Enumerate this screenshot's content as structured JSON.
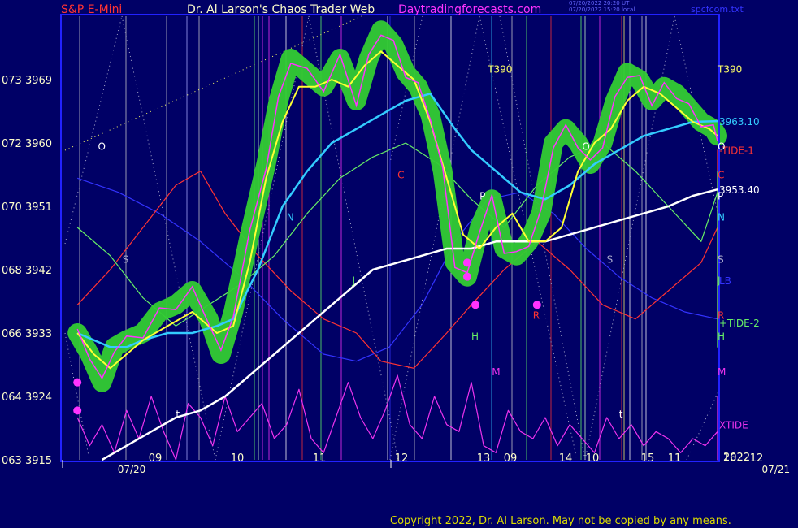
{
  "header": {
    "left_title": "S&P E-Mini",
    "center_title": "Dr. Al Larson's Chaos Trader Web",
    "site": "Daytradingforecasts.com",
    "file": "spcfcom.txt",
    "stamp_line1": "07/20/2022 20:20 UT",
    "stamp_line2": "07/20/2022 15:20 local"
  },
  "copyright": "Copyright 2022, Dr. Al Larson. May not be copied by any means.",
  "colors": {
    "background": "#000066",
    "frame": "#2222ff",
    "price_box": "#33cc33",
    "price": "#ff33ff",
    "short_ma": "#ffff33",
    "long_ma": "#33ccff",
    "trend": "#ffffff",
    "tide1": "#ff3333",
    "tide2": "#66ee66",
    "lb": "#3333ff",
    "xtide": "#ee33ee"
  },
  "chart_data": {
    "type": "line",
    "title": "S&P E-Mini",
    "ylim": [
      3915,
      3978
    ],
    "xlim": [
      8.2,
      16.05
    ],
    "y_ticks": [
      {
        "label": "063 3915",
        "value": 3915
      },
      {
        "label": "064 3924",
        "value": 3924
      },
      {
        "label": "066 3933",
        "value": 3933
      },
      {
        "label": "068 3942",
        "value": 3942
      },
      {
        "label": "070 3951",
        "value": 3951
      },
      {
        "label": "072 3960",
        "value": 3960
      },
      {
        "label": "073 3969",
        "value": 3969
      }
    ],
    "x_ticks_day1": [
      {
        "label": "09",
        "x": 9
      },
      {
        "label": "10",
        "x": 10
      },
      {
        "label": "11",
        "x": 11
      },
      {
        "label": "12",
        "x": 12
      },
      {
        "label": "13",
        "x": 13
      },
      {
        "label": "14",
        "x": 14
      },
      {
        "label": "15",
        "x": 15
      },
      {
        "label": "16",
        "x": 16
      }
    ],
    "x_ticks_day2": [
      {
        "label": "09",
        "x": 9
      },
      {
        "label": "10",
        "x": 10
      },
      {
        "label": "11",
        "x": 11
      },
      {
        "label": "12",
        "x": 12
      },
      {
        "label": "13",
        "x": 13
      },
      {
        "label": "14",
        "x": 14
      },
      {
        "label": "15",
        "x": 15
      },
      {
        "label": "13",
        "x": 16
      }
    ],
    "date_labels": [
      {
        "text": "07/20",
        "x": 8.7
      },
      {
        "text": "07/21",
        "x": 16.55
      }
    ],
    "year_label": "2022",
    "right_labels": [
      {
        "text": "3963.10",
        "value": 3963.1,
        "color": "#33ccff"
      },
      {
        "text": "-TIDE-1",
        "value": 3959.0,
        "color": "#ff3333"
      },
      {
        "text": "3953.40",
        "value": 3953.4,
        "color": "#ffffff"
      },
      {
        "text": "LB",
        "value": 3940.5,
        "color": "#3333ff"
      },
      {
        "text": "+TIDE-2",
        "value": 3934.5,
        "color": "#66ee66"
      },
      {
        "text": "XTIDE",
        "value": 3920.0,
        "color": "#ee33ee"
      }
    ],
    "series": [
      {
        "name": "S&P E-Mini",
        "x": [
          8.2,
          8.35,
          8.5,
          8.65,
          8.8,
          9.0,
          9.2,
          9.4,
          9.6,
          9.8,
          9.95,
          10.1,
          10.3,
          10.5,
          10.65,
          10.8,
          11.0,
          11.2,
          11.4,
          11.6,
          11.75,
          11.9,
          12.05,
          12.2,
          12.35,
          12.5,
          12.65,
          12.8,
          12.95,
          13.1,
          13.25,
          13.4,
          13.55,
          13.7,
          13.85,
          14.0,
          14.15,
          14.3,
          14.45,
          14.6,
          14.75,
          14.9,
          15.05,
          15.2,
          15.35,
          15.5,
          15.65,
          15.8,
          15.95,
          16.0
        ],
        "y": [
          3933,
          3930,
          3926,
          3931,
          3932,
          3933,
          3936,
          3937,
          3939,
          3935,
          3930,
          3936,
          3947,
          3957,
          3966,
          3972,
          3970,
          3968,
          3972,
          3966,
          3972,
          3976,
          3974,
          3970,
          3968,
          3964,
          3956,
          3943,
          3941,
          3948,
          3952,
          3945,
          3944,
          3946,
          3950,
          3960,
          3962,
          3960,
          3957,
          3960,
          3966,
          3970,
          3969,
          3966,
          3968,
          3967,
          3965,
          3963,
          3962,
          3961
        ]
      },
      {
        "name": "",
        "x": [
          8.2,
          8.4,
          8.6,
          8.8,
          9.0,
          9.3,
          9.6,
          9.9,
          10.1,
          10.3,
          10.5,
          10.7,
          10.9,
          11.1,
          11.3,
          11.5,
          11.7,
          11.9,
          12.1,
          12.3,
          12.5,
          12.7,
          12.9,
          13.1,
          13.3,
          13.5,
          13.7,
          13.9,
          14.1,
          14.3,
          14.5,
          14.7,
          14.9,
          15.1,
          15.3,
          15.5,
          15.7,
          15.9,
          16.0
        ],
        "y": [
          3933,
          3930,
          3928,
          3930,
          3932,
          3934,
          3936,
          3933,
          3934,
          3943,
          3955,
          3963,
          3968,
          3968,
          3969,
          3968,
          3971,
          3973,
          3971,
          3969,
          3963,
          3955,
          3947,
          3945,
          3948,
          3950,
          3946,
          3946,
          3948,
          3956,
          3960,
          3962,
          3966,
          3968,
          3967,
          3965,
          3963,
          3962,
          3961
        ]
      },
      {
        "name": "",
        "x": [
          8.2,
          8.4,
          8.6,
          8.8,
          9.0,
          9.3,
          9.6,
          9.9,
          10.1,
          10.4,
          10.7,
          11.0,
          11.3,
          11.6,
          11.9,
          12.2,
          12.5,
          12.8,
          13.0,
          13.3,
          13.6,
          13.9,
          14.2,
          14.5,
          14.8,
          15.1,
          15.4,
          15.7,
          16.0
        ],
        "y": [
          3933,
          3932,
          3931,
          3931,
          3932,
          3933,
          3933,
          3934,
          3935,
          3942,
          3951,
          3956,
          3960,
          3962,
          3964,
          3966,
          3967,
          3962,
          3959,
          3956,
          3953,
          3952,
          3954,
          3957,
          3959,
          3961,
          3962,
          3963,
          3963.1
        ]
      },
      {
        "name": "",
        "x": [
          8.5,
          8.8,
          9.1,
          9.4,
          9.7,
          10.0,
          10.3,
          10.6,
          10.9,
          11.2,
          11.5,
          11.8,
          12.1,
          12.4,
          12.7,
          13.0,
          13.3,
          13.6,
          13.9,
          14.2,
          14.5,
          14.8,
          15.1,
          15.4,
          15.7,
          16.0
        ],
        "y": [
          3915,
          3917,
          3919,
          3921,
          3922,
          3924,
          3927,
          3930,
          3933,
          3936,
          3939,
          3942,
          3943,
          3944,
          3945,
          3945,
          3946,
          3946,
          3946,
          3947,
          3948,
          3949,
          3950,
          3951,
          3952.5,
          3953.4
        ]
      },
      {
        "name": "-TIDE-1",
        "x": [
          8.2,
          8.6,
          9.0,
          9.4,
          9.7,
          10.0,
          10.4,
          10.8,
          11.2,
          11.6,
          11.9,
          12.3,
          12.7,
          13.0,
          13.4,
          13.8,
          14.2,
          14.6,
          15.0,
          15.4,
          15.8,
          16.3,
          16.8,
          17.2,
          17.6,
          18.0,
          18.4,
          18.8,
          19.2,
          19.6,
          20.0,
          20.4,
          20.8,
          21.2,
          21.6,
          22.0,
          22.4,
          22.8,
          23.0
        ],
        "y": [
          3937,
          3942,
          3948,
          3954,
          3956,
          3950,
          3944,
          3939,
          3935,
          3933,
          3929,
          3928,
          3933,
          3937,
          3942,
          3946,
          3942,
          3937,
          3935,
          3939,
          3943,
          3948,
          3958,
          3959,
          3951,
          3943,
          3938,
          3933,
          3934,
          3938,
          3943,
          3947,
          3945,
          3940,
          3937,
          3936,
          3941,
          3950,
          3958
        ]
      },
      {
        "name": "+TIDE-2",
        "x": [
          8.2,
          8.6,
          9.0,
          9.4,
          9.8,
          10.2,
          10.6,
          11.0,
          11.4,
          11.8,
          12.2,
          12.6,
          13.0,
          13.4,
          13.8,
          14.2,
          14.6,
          15.0,
          15.4,
          15.8,
          16.2,
          16.6,
          17.0,
          17.4,
          17.8,
          18.2,
          18.6,
          19.0,
          19.4,
          19.8,
          20.2,
          20.6,
          21.0,
          21.4,
          21.8,
          22.2,
          22.6,
          23.0
        ],
        "y": [
          3948,
          3944,
          3938,
          3934,
          3937,
          3940,
          3944,
          3950,
          3955,
          3958,
          3960,
          3957,
          3952,
          3948,
          3954,
          3958,
          3960,
          3956,
          3951,
          3946,
          3953,
          3945,
          3937,
          3931,
          3942,
          3949,
          3946,
          3944,
          3954,
          3956,
          3956,
          3950,
          3944,
          3946,
          3954,
          3952,
          3944,
          3933
        ]
      },
      {
        "name": "LB",
        "x": [
          8.2,
          8.7,
          9.2,
          9.7,
          10.2,
          10.7,
          11.2,
          11.6,
          12.0,
          12.4,
          12.8,
          13.2,
          13.6,
          14.0,
          14.4,
          14.8,
          15.2,
          15.6,
          16.0
        ],
        "y": [
          3955,
          3953,
          3950,
          3946,
          3941,
          3935,
          3930,
          3929,
          3931,
          3937,
          3946,
          3952,
          3953,
          3950,
          3945,
          3941,
          3938,
          3936,
          3935
        ]
      },
      {
        "name": "XTIDE",
        "x": [
          8.2,
          8.35,
          8.5,
          8.65,
          8.8,
          8.95,
          9.1,
          9.25,
          9.4,
          9.55,
          9.7,
          9.85,
          10.0,
          10.15,
          10.3,
          10.45,
          10.6,
          10.75,
          10.9,
          11.05,
          11.2,
          11.35,
          11.5,
          11.65,
          11.8,
          11.95,
          12.1,
          12.25,
          12.4,
          12.55,
          12.7,
          12.85,
          13.0,
          13.15,
          13.3,
          13.45,
          13.6,
          13.75,
          13.9,
          14.05,
          14.2,
          14.35,
          14.5,
          14.65,
          14.8,
          14.95,
          15.1,
          15.25,
          15.4,
          15.55,
          15.7,
          15.85,
          16.0,
          16.3,
          16.6,
          16.9,
          17.2,
          17.5,
          17.8,
          18.1,
          18.4,
          18.7,
          19.0,
          19.3,
          19.6,
          19.9,
          20.2,
          20.5,
          20.8,
          21.1,
          21.4,
          21.7,
          22.0,
          22.3,
          22.6,
          22.9,
          23.0
        ],
        "y": [
          3921,
          3917,
          3920,
          3916,
          3922,
          3918,
          3924,
          3919,
          3915,
          3923,
          3921,
          3917,
          3924,
          3919,
          3921,
          3923,
          3918,
          3920,
          3925,
          3918,
          3916,
          3921,
          3926,
          3921,
          3918,
          3922,
          3927,
          3920,
          3918,
          3924,
          3920,
          3919,
          3926,
          3917,
          3916,
          3922,
          3919,
          3918,
          3921,
          3917,
          3920,
          3918,
          3916,
          3921,
          3918,
          3920,
          3917,
          3919,
          3918,
          3916,
          3918,
          3917,
          3919,
          3917,
          3915,
          3918,
          3916,
          3921,
          3923,
          3917,
          3924,
          3918,
          3922,
          3917,
          3921,
          3917,
          3916,
          3919,
          3917,
          3918,
          3916,
          3919,
          3917,
          3918,
          3918,
          3919,
          3919
        ]
      }
    ],
    "lows_markers": [
      {
        "x": 8.2,
        "y": 3926
      },
      {
        "x": 8.2,
        "y": 3922
      },
      {
        "x": 12.95,
        "y": 3943
      },
      {
        "x": 12.95,
        "y": 3941
      },
      {
        "x": 13.05,
        "y": 3937
      },
      {
        "x": 13.8,
        "y": 3937
      }
    ],
    "annotations": [
      {
        "text": "T390",
        "x": 13.2,
        "y": 3970,
        "color": "#ffff66"
      },
      {
        "text": "T390",
        "x": 21.8,
        "y": 3970,
        "color": "#ffff66"
      },
      {
        "text": "O",
        "x": 8.45,
        "y": 3959,
        "color": "#ffffff"
      },
      {
        "text": "O",
        "x": 14.35,
        "y": 3959,
        "color": "#ffffff"
      },
      {
        "text": "O",
        "x": 22.3,
        "y": 3959,
        "color": "#ffffff"
      },
      {
        "text": "S",
        "x": 8.75,
        "y": 3943,
        "color": "#aaaacc"
      },
      {
        "text": "S",
        "x": 14.65,
        "y": 3943,
        "color": "#aaaacc"
      },
      {
        "text": "S",
        "x": 16.85,
        "y": 3943,
        "color": "#aaaacc"
      },
      {
        "text": "S",
        "x": 22.55,
        "y": 3943,
        "color": "#aaaacc"
      },
      {
        "text": "N",
        "x": 10.75,
        "y": 3949,
        "color": "#33ccff"
      },
      {
        "text": "N",
        "x": 18.7,
        "y": 3949,
        "color": "#33ccff"
      },
      {
        "text": "C",
        "x": 12.1,
        "y": 3955,
        "color": "#ff3333"
      },
      {
        "text": "C",
        "x": 20.0,
        "y": 3955,
        "color": "#ff3333"
      },
      {
        "text": "P",
        "x": 13.1,
        "y": 3952,
        "color": "#ffffff"
      },
      {
        "text": "P",
        "x": 20.8,
        "y": 3952,
        "color": "#ffffff"
      },
      {
        "text": "H",
        "x": 13.0,
        "y": 3932,
        "color": "#66ee66"
      },
      {
        "text": "H",
        "x": 20.85,
        "y": 3932,
        "color": "#66ee66"
      },
      {
        "text": "M",
        "x": 13.25,
        "y": 3927,
        "color": "#ee33ee"
      },
      {
        "text": "M",
        "x": 21.35,
        "y": 3927,
        "color": "#ee33ee"
      },
      {
        "text": "R",
        "x": 13.75,
        "y": 3935,
        "color": "#ff3333"
      },
      {
        "text": "R",
        "x": 21.75,
        "y": 3935,
        "color": "#ff3333"
      },
      {
        "text": "J",
        "x": 11.55,
        "y": 3940,
        "color": "#66ee66"
      },
      {
        "text": "J",
        "x": 19.45,
        "y": 3940,
        "color": "#66ee66"
      },
      {
        "text": "t",
        "x": 9.4,
        "y": 3921,
        "color": "#ffffff"
      },
      {
        "text": "t",
        "x": 14.8,
        "y": 3921,
        "color": "#ffffff"
      }
    ],
    "grid": false,
    "legend": "right"
  }
}
